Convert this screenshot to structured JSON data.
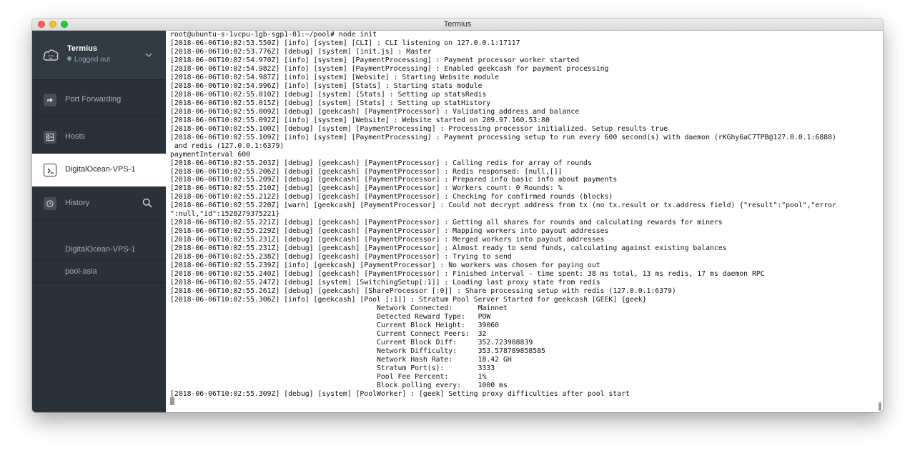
{
  "window": {
    "title": "Termius"
  },
  "sidebar": {
    "account": {
      "name": "Termius",
      "status": "Logged out"
    },
    "items": [
      {
        "label": "Port Forwarding",
        "icon": "port-forwarding-icon"
      },
      {
        "label": "Hosts",
        "icon": "hosts-icon"
      },
      {
        "label": "DigitalOcean-VPS-1",
        "icon": "terminal-icon"
      },
      {
        "label": "History",
        "icon": "history-icon"
      }
    ],
    "history": [
      {
        "label": "DigitalOcean-VPS-1"
      },
      {
        "label": "pool-asia"
      }
    ]
  },
  "colors": {
    "sidebar_bg": "#2b3139",
    "account_bg": "#323a43",
    "active_item_bg": "#ffffff",
    "terminal_bg": "#ffffff",
    "terminal_text": "#111111"
  },
  "terminal": {
    "lines": [
      "root@ubuntu-s-1vcpu-1gb-sgp1-01:~/pool# node init",
      "[2018-06-06T10:02:53.550Z] [info] [system] [CLI] : CLI listening on 127.0.0.1:17117",
      "[2018-06-06T10:02:53.776Z] [debug] [system] [init.js] : Master",
      "[2018-06-06T10:02:54.970Z] [info] [system] [PaymentProcessing] : Payment processor worker started",
      "[2018-06-06T10:02:54.982Z] [info] [system] [PaymentProcessing] : Enabled geekcash for payment processing",
      "[2018-06-06T10:02:54.987Z] [info] [system] [Website] : Starting Website module",
      "[2018-06-06T10:02:54.996Z] [info] [system] [Stats] : Starting stats module",
      "[2018-06-06T10:02:55.010Z] [debug] [system] [Stats] : Setting up statsRedis",
      "[2018-06-06T10:02:55.015Z] [debug] [system] [Stats] : Setting up statHistory",
      "[2018-06-06T10:02:55.009Z] [debug] [geekcash] [PaymentProcessor] : Validating address and balance",
      "[2018-06-06T10:02:55.092Z] [info] [system] [Website] : Website started on 209.97.160.53:80",
      "[2018-06-06T10:02:55.100Z] [debug] [system] [PaymentProcessing] : Processing processor initialized. Setup results true",
      "[2018-06-06T10:02:55.109Z] [info] [system] [PaymentProcessing] : Payment processing setup to run every 600 second(s) with daemon (rKGhy6aC7TPB@127.0.0.1:6888)",
      " and redis (127.0.0.1:6379)",
      "paymentInterval 600",
      "[2018-06-06T10:02:55.203Z] [debug] [geekcash] [PaymentProcessor] : Calling redis for array of rounds",
      "[2018-06-06T10:02:55.206Z] [debug] [geekcash] [PaymentProcessor] : Redis responsed: [null,[]]",
      "[2018-06-06T10:02:55.209Z] [debug] [geekcash] [PaymentProcessor] : Prepared info basic info about payments",
      "[2018-06-06T10:02:55.210Z] [debug] [geekcash] [PaymentProcessor] : Workers count: 0 Rounds: %",
      "[2018-06-06T10:02:55.212Z] [debug] [geekcash] [PaymentProcessor] : Checking for confirmed rounds (blocks)",
      "[2018-06-06T10:02:55.220Z] [warn] [geekcash] [PaymentProcessor] : Could not decrypt address from tx (no tx.result or tx.address field) {\"result\":\"pool\",\"error",
      "\":null,\"id\":1528279375221}",
      "[2018-06-06T10:02:55.221Z] [debug] [geekcash] [PaymentProcessor] : Getting all shares for rounds and calculating rewards for miners",
      "[2018-06-06T10:02:55.229Z] [debug] [geekcash] [PaymentProcessor] : Mapping workers into payout addresses",
      "[2018-06-06T10:02:55.231Z] [debug] [geekcash] [PaymentProcessor] : Merged workers into payout addresses",
      "[2018-06-06T10:02:55.231Z] [debug] [geekcash] [PaymentProcessor] : Almost ready to send funds, calculating against existing balances",
      "[2018-06-06T10:02:55.238Z] [debug] [geekcash] [PaymentProcessor] : Trying to send",
      "[2018-06-06T10:02:55.239Z] [info] [geekcash] [PaymentProcessor] : No workers was chosen for paying out",
      "[2018-06-06T10:02:55.240Z] [debug] [geekcash] [PaymentProcessor] : Finished interval - time spent: 38 ms total, 13 ms redis, 17 ms daemon RPC",
      "[2018-06-06T10:02:55.247Z] [debug] [system] [SwitchingSetup[:1]] : Loading last proxy state from redis",
      "[2018-06-06T10:02:55.261Z] [debug] [geekcash] [ShareProcessor [:0]] : Share processing setup with redis (127.0.0.1:6379)",
      "[2018-06-06T10:02:55.306Z] [info] [geekcash] [Pool [:1]] : Stratum Pool Server Started for geekcash [GEEK] {geek}",
      "                                                 Network Connected:      Mainnet",
      "                                                 Detected Reward Type:   POW",
      "                                                 Current Block Height:   39060",
      "                                                 Current Connect Peers:  32",
      "                                                 Current Block Diff:     352.723908839",
      "                                                 Network Difficulty:     353.578789858585",
      "                                                 Network Hash Rate:      18.42 GH",
      "                                                 Stratum Port(s):        3333",
      "                                                 Pool Fee Percent:       1%",
      "                                                 Block polling every:    1000 ms",
      "[2018-06-06T10:02:55.309Z] [debug] [system] [PoolWorker] : [geek] Setting proxy difficulties after pool start"
    ]
  }
}
